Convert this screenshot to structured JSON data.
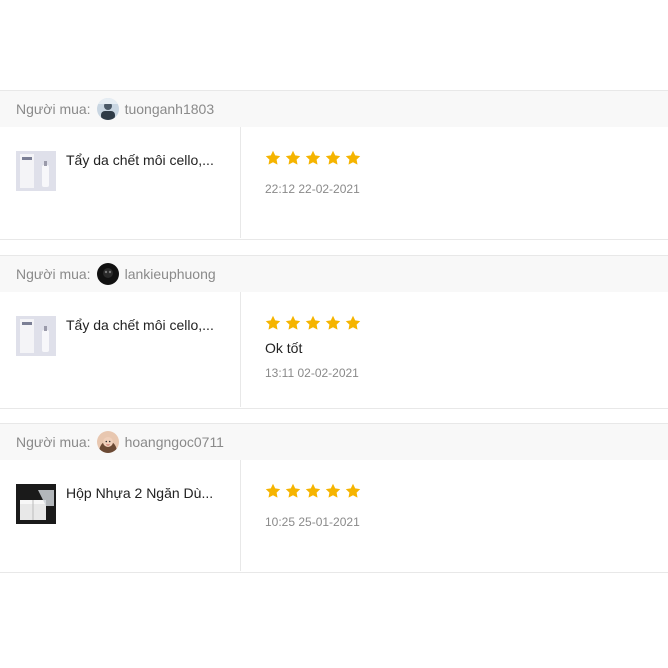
{
  "colors": {
    "star": "#f5b400",
    "muted": "#8a8a8a",
    "text": "#222222"
  },
  "reviews": [
    {
      "buyer_label": "Người mua:",
      "username": "tuonganh1803",
      "avatar": "avatar-photo-blue",
      "product_thumb": "cosmetic-bottle-image",
      "product_name": "Tẩy da chết môi cello,...",
      "stars": 5,
      "comment": "",
      "time": "22:12 22-02-2021"
    },
    {
      "buyer_label": "Người mua:",
      "username": "lankieuphuong",
      "avatar": "avatar-photo-dark",
      "product_thumb": "cosmetic-bottle-image",
      "product_name": "Tẩy da chết môi cello,...",
      "stars": 5,
      "comment": "Ok tốt",
      "time": "13:11 02-02-2021"
    },
    {
      "buyer_label": "Người mua:",
      "username": "hoangngoc0711",
      "avatar": "avatar-photo-portrait",
      "product_thumb": "plastic-box-image",
      "product_name": "Hộp Nhựa 2 Ngăn Dù...",
      "stars": 5,
      "comment": "",
      "time": "10:25 25-01-2021"
    }
  ]
}
